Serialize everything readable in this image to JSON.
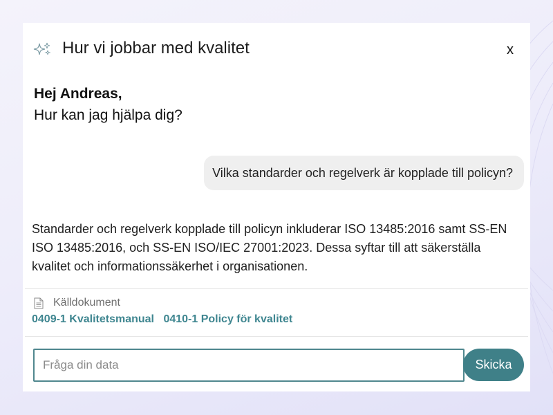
{
  "header": {
    "icon": "sparkle-icon",
    "title": "Hur vi jobbar med kvalitet",
    "close_label": "x"
  },
  "greeting": {
    "name": "Hej Andreas,",
    "question": "Hur kan jag hjälpa dig?"
  },
  "conversation": {
    "user_message": "Vilka standarder och regelverk är kopplade till policyn?",
    "assistant_answer": "Standarder och regelverk kopplade till policyn inkluderar ISO 13485:2016 samt SS-EN ISO 13485:2016, och SS-EN ISO/IEC 27001:2023. Dessa syftar till att säkerställa kvalitet och informationssäkerhet i organisationen."
  },
  "sources": {
    "icon": "document-icon",
    "label": "Källdokument",
    "documents": [
      "0409-1 Kvalitetsmanual",
      "0410-1 Policy för kvalitet"
    ]
  },
  "input": {
    "placeholder": "Fråga din data",
    "value": "",
    "send_label": "Skicka"
  },
  "colors": {
    "accent": "#3f8088",
    "link": "#3f8690",
    "bubble": "#efefef"
  }
}
